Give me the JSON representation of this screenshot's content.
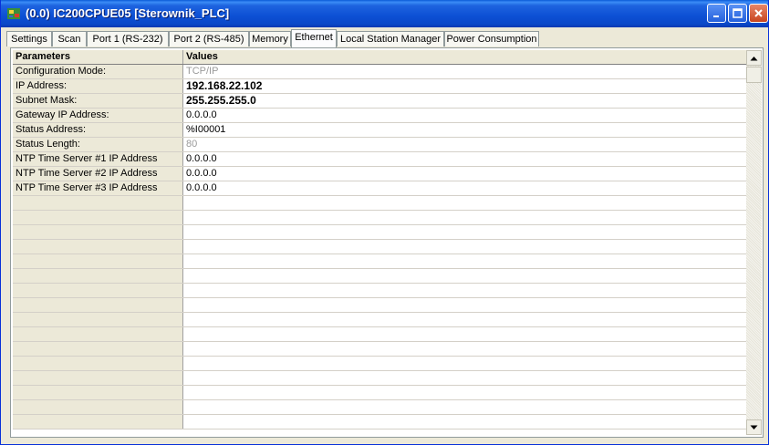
{
  "window": {
    "title": "(0.0) IC200CPUE05 [Sterownik_PLC]"
  },
  "tabs": [
    {
      "label": "Settings"
    },
    {
      "label": "Scan"
    },
    {
      "label": "Port 1 (RS-232)"
    },
    {
      "label": "Port 2 (RS-485)"
    },
    {
      "label": "Memory"
    },
    {
      "label": "Ethernet",
      "active": true
    },
    {
      "label": "Local Station Manager"
    },
    {
      "label": "Power Consumption"
    }
  ],
  "grid": {
    "headers": {
      "parameters": "Parameters",
      "values": "Values"
    },
    "rows": [
      {
        "param": "Configuration Mode:",
        "value": "TCP/IP"
      },
      {
        "param": "IP Address:",
        "value": "192.168.22.102"
      },
      {
        "param": "Subnet Mask:",
        "value": "255.255.255.0"
      },
      {
        "param": "Gateway IP Address:",
        "value": "0.0.0.0"
      },
      {
        "param": "Status Address:",
        "value": "%I00001"
      },
      {
        "param": "Status Length:",
        "value": "80"
      },
      {
        "param": "NTP Time Server #1 IP Address",
        "value": "0.0.0.0"
      },
      {
        "param": "NTP Time Server #2 IP Address",
        "value": "0.0.0.0"
      },
      {
        "param": "NTP Time Server #3 IP Address",
        "value": "0.0.0.0"
      }
    ]
  }
}
